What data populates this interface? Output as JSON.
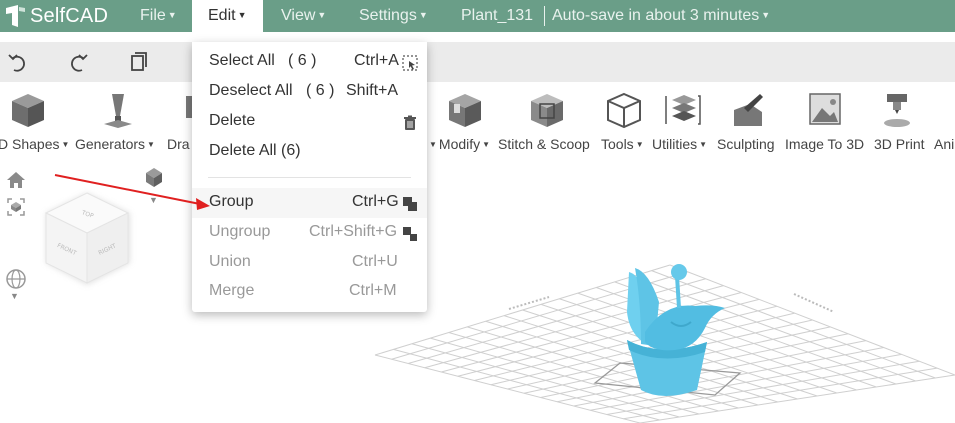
{
  "app": {
    "name": "SelfCAD"
  },
  "topbar": {
    "file": "File",
    "edit": "Edit",
    "view": "View",
    "settings": "Settings",
    "project_name": "Plant_131",
    "autosave": "Auto-save in about 3 minutes",
    "color": "#6a9e88"
  },
  "history": {
    "undo_icon": "undo-icon",
    "redo_icon": "redo-icon",
    "copy_icon": "copy-icon"
  },
  "ribbon": {
    "tools": [
      {
        "label": "D Shapes",
        "icon": "cube-icon"
      },
      {
        "label": "Generators",
        "icon": "generator-icon"
      },
      {
        "label": "Dra",
        "icon": "draw-icon"
      },
      {
        "label": "Modify",
        "icon": "modify-icon"
      },
      {
        "label": "Stitch & Scoop",
        "icon": "stitch-scoop-icon"
      },
      {
        "label": "Tools",
        "icon": "tools-cube-icon"
      },
      {
        "label": "Utilities",
        "icon": "utilities-icon"
      },
      {
        "label": "Sculpting",
        "icon": "sculpting-icon"
      },
      {
        "label": "Image To 3D",
        "icon": "image-to-3d-icon"
      },
      {
        "label": "3D Print",
        "icon": "3d-print-icon"
      },
      {
        "label": "Ani",
        "icon": "animation-icon"
      }
    ]
  },
  "viewcube": {
    "face_top": "TOP",
    "face_front": "FRONT",
    "face_right": "RIGHT"
  },
  "edit_menu": {
    "items": [
      {
        "label": "Select All",
        "count": "( 6 )",
        "shortcut": "Ctrl+A",
        "enabled": true
      },
      {
        "label": "Deselect All",
        "count": "( 6 )",
        "shortcut": "Shift+A",
        "enabled": true
      },
      {
        "label": "Delete",
        "shortcut": "",
        "enabled": true
      },
      {
        "label": "Delete All (6)",
        "shortcut": "",
        "enabled": true
      },
      {
        "label": "Group",
        "shortcut": "Ctrl+G",
        "enabled": true
      },
      {
        "label": "Ungroup",
        "shortcut": "Ctrl+Shift+G",
        "enabled": false
      },
      {
        "label": "Union",
        "shortcut": "Ctrl+U",
        "enabled": false
      },
      {
        "label": "Merge",
        "shortcut": "Ctrl+M",
        "enabled": false
      }
    ]
  },
  "colors": {
    "model": "#5ec4e6",
    "annotation_arrow": "#e02020",
    "grid": "#cfcfcf"
  }
}
